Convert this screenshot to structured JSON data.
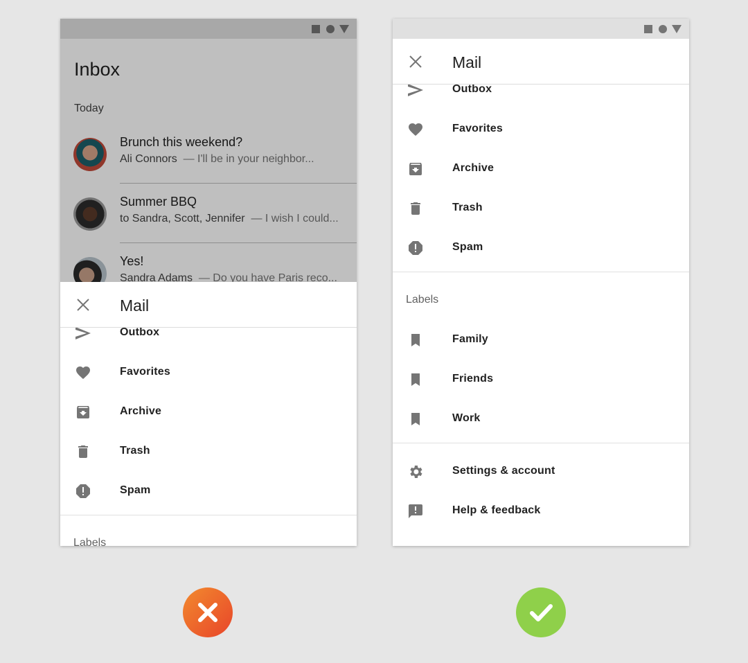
{
  "left_phone": {
    "inbox_title": "Inbox",
    "section": "Today",
    "emails": [
      {
        "subject": "Brunch this weekend?",
        "sender": "Ali Connors",
        "preview": "— I'll be in your neighbor..."
      },
      {
        "subject": "Summer BBQ",
        "sender": "to Sandra, Scott, Jennifer",
        "preview": "— I wish I could..."
      },
      {
        "subject": "Yes!",
        "sender": "Sandra Adams",
        "preview": "— Do you have Paris reco..."
      }
    ]
  },
  "drawer": {
    "title": "Mail",
    "items": [
      {
        "label": "Outbox",
        "icon": "send-icon"
      },
      {
        "label": "Favorites",
        "icon": "heart-icon"
      },
      {
        "label": "Archive",
        "icon": "archive-icon"
      },
      {
        "label": "Trash",
        "icon": "trash-icon"
      },
      {
        "label": "Spam",
        "icon": "spam-icon"
      }
    ],
    "labels_header": "Labels",
    "labels": [
      {
        "label": "Family",
        "icon": "bookmark-icon"
      },
      {
        "label": "Friends",
        "icon": "bookmark-icon"
      },
      {
        "label": "Work",
        "icon": "bookmark-icon"
      }
    ],
    "footer": [
      {
        "label": "Settings & account",
        "icon": "gear-icon"
      },
      {
        "label": "Help & feedback",
        "icon": "feedback-icon"
      }
    ]
  },
  "verdicts": {
    "dont": "incorrect",
    "do": "correct",
    "dont_color": "#ee5a2a",
    "do_color": "#8fd04a"
  }
}
